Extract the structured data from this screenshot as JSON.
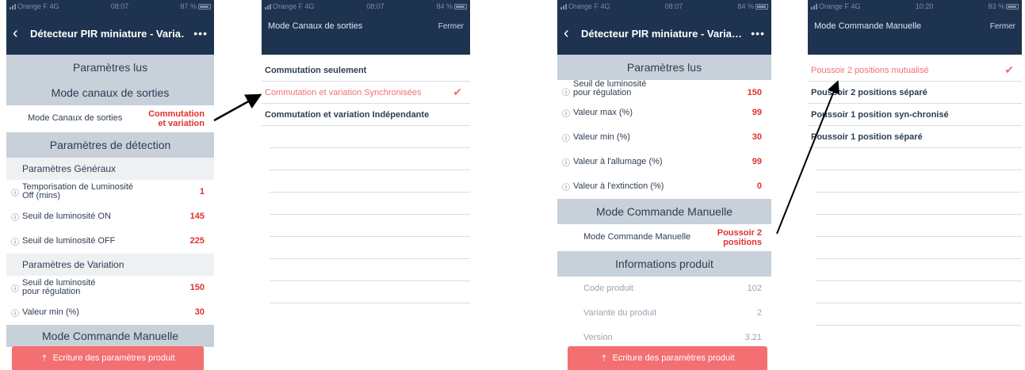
{
  "phone1": {
    "status": {
      "carrier": "Orange F  4G",
      "time": "08:07",
      "battery": "87 %"
    },
    "title": "Détecteur PIR miniature - Varia…",
    "more": "•••",
    "sections": {
      "read": "Paramètres lus",
      "channels": "Mode canaux de sorties",
      "detection": "Paramètres de détection",
      "general": "Paramètres Généraux",
      "variation": "Paramètres de Variation",
      "manual": "Mode Commande Manuelle"
    },
    "channel_row": {
      "label": "Mode Canaux de sorties",
      "value1": "Commutation",
      "value2": "et variation"
    },
    "rows": [
      {
        "label1": "Temporisation de Luminosité",
        "label2": "Off  (mins)",
        "value": "1"
      },
      {
        "label1": "Seuil de luminosité ON",
        "label2": "",
        "value": "145"
      },
      {
        "label1": "Seuil de luminosité OFF",
        "label2": "",
        "value": "225"
      }
    ],
    "var_rows": [
      {
        "label1": "Seuil de luminosité",
        "label2": "pour régulation",
        "value": "150"
      },
      {
        "label1": "Valeur min (%)",
        "label2": "",
        "value": "30"
      }
    ],
    "cta": "Ecriture des paramètres produit"
  },
  "phone2": {
    "status": {
      "carrier": "Orange F  4G",
      "time": "08:07",
      "battery": "84 %"
    },
    "title": "Mode Canaux de sorties",
    "close": "Fermer",
    "options": [
      {
        "label": "Commutation seulement",
        "selected": false
      },
      {
        "label": "Commutation et variation Synchronisées",
        "selected": true
      },
      {
        "label": "Commutation et variation Indépendante",
        "selected": false
      }
    ]
  },
  "phone3": {
    "status": {
      "carrier": "Orange F  4G",
      "time": "08:07",
      "battery": "84 %"
    },
    "title": "Détecteur PIR miniature - Varia…",
    "more": "•••",
    "sections": {
      "read": "Paramètres lus",
      "manual": "Mode Commande Manuelle",
      "info": "Informations produit"
    },
    "rows": [
      {
        "label1": "Seuil de luminosité",
        "label2": "pour régulation",
        "value": "150"
      },
      {
        "label1": "Valeur max (%)",
        "label2": "",
        "value": "99"
      },
      {
        "label1": "Valeur min (%)",
        "label2": "",
        "value": "30"
      },
      {
        "label1": "Valeur à l'allumage (%)",
        "label2": "",
        "value": "99"
      },
      {
        "label1": "Valeur à l'extinction (%)",
        "label2": "",
        "value": "0"
      }
    ],
    "manual_row": {
      "label": "Mode Commande Manuelle",
      "value1": "Poussoir 2",
      "value2": "positions"
    },
    "info_rows": [
      {
        "label": "Code produit",
        "value": "102"
      },
      {
        "label": "Variante du produit",
        "value": "2"
      },
      {
        "label": "Version",
        "value": "3.21"
      }
    ],
    "cta": "Ecriture des paramètres produit"
  },
  "phone4": {
    "status": {
      "carrier": "Orange F  4G",
      "time": "10:20",
      "battery": "83 %"
    },
    "title": "Mode Commande Manuelle",
    "close": "Fermer",
    "options": [
      {
        "label": "Poussoir 2 positions mutualisé",
        "selected": true
      },
      {
        "label": "Poussoir 2 positions séparé",
        "selected": false
      },
      {
        "label": "Poussoir 1 position syn-chronisé",
        "selected": false
      },
      {
        "label": "Poussoir 1 position séparé",
        "selected": false
      }
    ]
  },
  "icons": {
    "info": "ⓘ",
    "check": "✔",
    "back": "‹",
    "upload": "⇡"
  },
  "colors": {
    "nav": "#1e3350",
    "accent": "#f36f71",
    "value": "#e0312f",
    "section": "#c8d0da"
  }
}
